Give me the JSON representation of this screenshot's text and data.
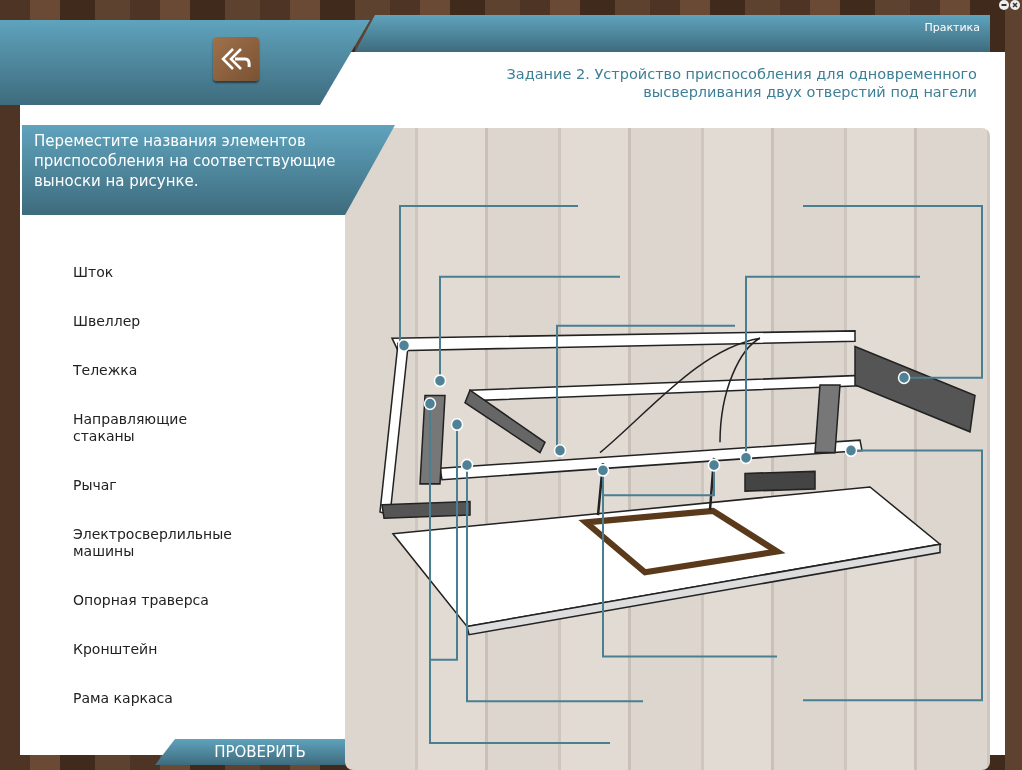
{
  "header": {
    "section": "Практика",
    "title_lines": [
      "Задание 2. Устройство приспособления для одновременного",
      "высверливания двух отверстий под нагели"
    ]
  },
  "instruction": "Переместите названия элементов приспособления на соответствующие выноски на рисунке.",
  "items": [
    {
      "label": "Шток"
    },
    {
      "label": "Швеллер"
    },
    {
      "label": "Тележка"
    },
    {
      "label": "Направляющие стаканы"
    },
    {
      "label": "Рычаг"
    },
    {
      "label": "Электросверлильные машины"
    },
    {
      "label": "Опорная траверса"
    },
    {
      "label": "Кронштейн"
    },
    {
      "label": "Рама каркаса"
    }
  ],
  "check_button": "ПРОВЕРИТЬ"
}
